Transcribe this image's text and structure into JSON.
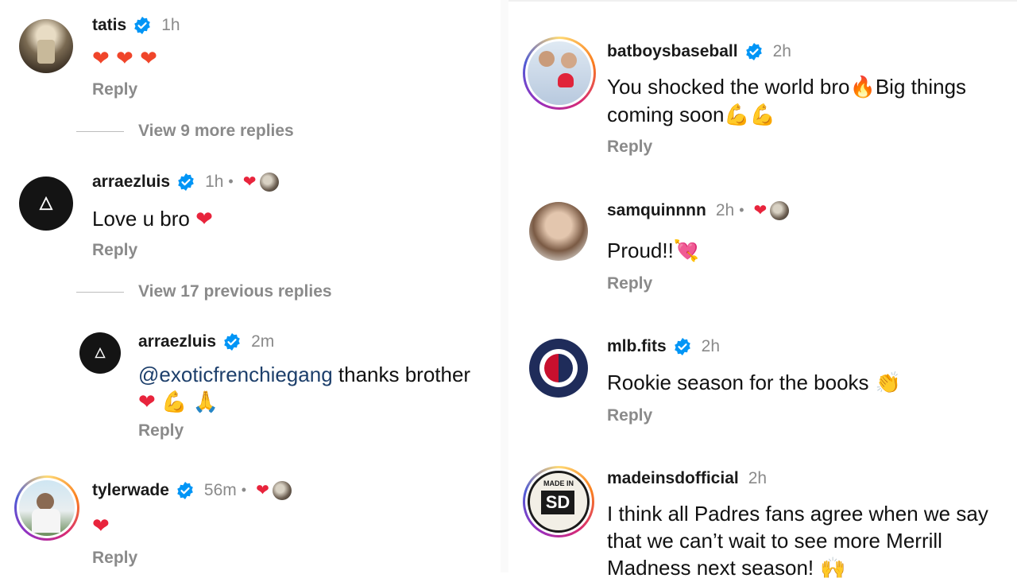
{
  "left": {
    "c1": {
      "username": "tatis",
      "time": "1h",
      "reply": "Reply"
    },
    "view1": "View 9 more replies",
    "c2": {
      "username": "arraezluis",
      "time": "1h",
      "text": "Love u bro",
      "reply": "Reply"
    },
    "view2": "View 17 previous replies",
    "c3": {
      "username": "arraezluis",
      "time": "2m",
      "mention": "@exoticfrenchiegang",
      "text": " thanks brother",
      "reply": "Reply"
    },
    "c4": {
      "username": "tylerwade",
      "time": "56m",
      "reply": "Reply"
    }
  },
  "right": {
    "c1": {
      "username": "batboysbaseball",
      "time": "2h",
      "text_line1": "You shocked the world bro",
      "text_line1b": "Big things",
      "text_line2": "coming soon",
      "reply": "Reply"
    },
    "c2": {
      "username": "samquinnnn",
      "time": "2h",
      "text": "Proud!!",
      "reply": "Reply"
    },
    "c3": {
      "username": "mlb.fits",
      "time": "2h",
      "text": "Rookie season for the books",
      "reply": "Reply"
    },
    "c4": {
      "username": "madeinsdofficial",
      "time": "2h",
      "line1": "I think all Padres fans agree when we say",
      "line2": "that we can’t wait to see more Merrill",
      "line3": "Madness next season!",
      "logo_text": "SD",
      "logo_top": "MADE IN"
    }
  },
  "icons": {
    "verified": "verified-badge-icon",
    "heart": "heart-icon"
  },
  "colors": {
    "verified": "#0095f6",
    "heart": "#e8243c",
    "muted": "#8a8a8a",
    "mention": "#1d3f6b"
  }
}
